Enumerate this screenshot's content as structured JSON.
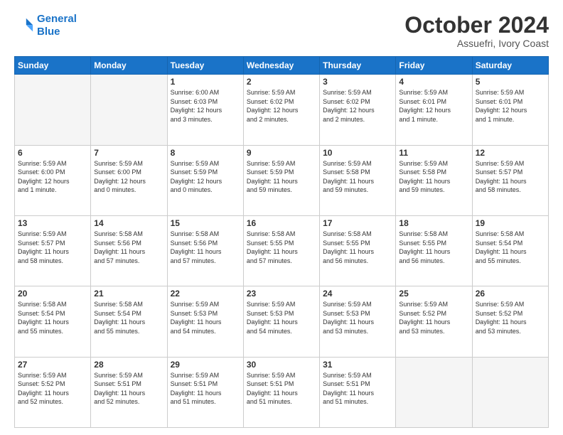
{
  "header": {
    "logo_line1": "General",
    "logo_line2": "Blue",
    "month": "October 2024",
    "location": "Assuefri, Ivory Coast"
  },
  "weekdays": [
    "Sunday",
    "Monday",
    "Tuesday",
    "Wednesday",
    "Thursday",
    "Friday",
    "Saturday"
  ],
  "weeks": [
    [
      {
        "day": "",
        "info": ""
      },
      {
        "day": "",
        "info": ""
      },
      {
        "day": "1",
        "info": "Sunrise: 6:00 AM\nSunset: 6:03 PM\nDaylight: 12 hours\nand 3 minutes."
      },
      {
        "day": "2",
        "info": "Sunrise: 5:59 AM\nSunset: 6:02 PM\nDaylight: 12 hours\nand 2 minutes."
      },
      {
        "day": "3",
        "info": "Sunrise: 5:59 AM\nSunset: 6:02 PM\nDaylight: 12 hours\nand 2 minutes."
      },
      {
        "day": "4",
        "info": "Sunrise: 5:59 AM\nSunset: 6:01 PM\nDaylight: 12 hours\nand 1 minute."
      },
      {
        "day": "5",
        "info": "Sunrise: 5:59 AM\nSunset: 6:01 PM\nDaylight: 12 hours\nand 1 minute."
      }
    ],
    [
      {
        "day": "6",
        "info": "Sunrise: 5:59 AM\nSunset: 6:00 PM\nDaylight: 12 hours\nand 1 minute."
      },
      {
        "day": "7",
        "info": "Sunrise: 5:59 AM\nSunset: 6:00 PM\nDaylight: 12 hours\nand 0 minutes."
      },
      {
        "day": "8",
        "info": "Sunrise: 5:59 AM\nSunset: 5:59 PM\nDaylight: 12 hours\nand 0 minutes."
      },
      {
        "day": "9",
        "info": "Sunrise: 5:59 AM\nSunset: 5:59 PM\nDaylight: 11 hours\nand 59 minutes."
      },
      {
        "day": "10",
        "info": "Sunrise: 5:59 AM\nSunset: 5:58 PM\nDaylight: 11 hours\nand 59 minutes."
      },
      {
        "day": "11",
        "info": "Sunrise: 5:59 AM\nSunset: 5:58 PM\nDaylight: 11 hours\nand 59 minutes."
      },
      {
        "day": "12",
        "info": "Sunrise: 5:59 AM\nSunset: 5:57 PM\nDaylight: 11 hours\nand 58 minutes."
      }
    ],
    [
      {
        "day": "13",
        "info": "Sunrise: 5:59 AM\nSunset: 5:57 PM\nDaylight: 11 hours\nand 58 minutes."
      },
      {
        "day": "14",
        "info": "Sunrise: 5:58 AM\nSunset: 5:56 PM\nDaylight: 11 hours\nand 57 minutes."
      },
      {
        "day": "15",
        "info": "Sunrise: 5:58 AM\nSunset: 5:56 PM\nDaylight: 11 hours\nand 57 minutes."
      },
      {
        "day": "16",
        "info": "Sunrise: 5:58 AM\nSunset: 5:55 PM\nDaylight: 11 hours\nand 57 minutes."
      },
      {
        "day": "17",
        "info": "Sunrise: 5:58 AM\nSunset: 5:55 PM\nDaylight: 11 hours\nand 56 minutes."
      },
      {
        "day": "18",
        "info": "Sunrise: 5:58 AM\nSunset: 5:55 PM\nDaylight: 11 hours\nand 56 minutes."
      },
      {
        "day": "19",
        "info": "Sunrise: 5:58 AM\nSunset: 5:54 PM\nDaylight: 11 hours\nand 55 minutes."
      }
    ],
    [
      {
        "day": "20",
        "info": "Sunrise: 5:58 AM\nSunset: 5:54 PM\nDaylight: 11 hours\nand 55 minutes."
      },
      {
        "day": "21",
        "info": "Sunrise: 5:58 AM\nSunset: 5:54 PM\nDaylight: 11 hours\nand 55 minutes."
      },
      {
        "day": "22",
        "info": "Sunrise: 5:59 AM\nSunset: 5:53 PM\nDaylight: 11 hours\nand 54 minutes."
      },
      {
        "day": "23",
        "info": "Sunrise: 5:59 AM\nSunset: 5:53 PM\nDaylight: 11 hours\nand 54 minutes."
      },
      {
        "day": "24",
        "info": "Sunrise: 5:59 AM\nSunset: 5:53 PM\nDaylight: 11 hours\nand 53 minutes."
      },
      {
        "day": "25",
        "info": "Sunrise: 5:59 AM\nSunset: 5:52 PM\nDaylight: 11 hours\nand 53 minutes."
      },
      {
        "day": "26",
        "info": "Sunrise: 5:59 AM\nSunset: 5:52 PM\nDaylight: 11 hours\nand 53 minutes."
      }
    ],
    [
      {
        "day": "27",
        "info": "Sunrise: 5:59 AM\nSunset: 5:52 PM\nDaylight: 11 hours\nand 52 minutes."
      },
      {
        "day": "28",
        "info": "Sunrise: 5:59 AM\nSunset: 5:51 PM\nDaylight: 11 hours\nand 52 minutes."
      },
      {
        "day": "29",
        "info": "Sunrise: 5:59 AM\nSunset: 5:51 PM\nDaylight: 11 hours\nand 51 minutes."
      },
      {
        "day": "30",
        "info": "Sunrise: 5:59 AM\nSunset: 5:51 PM\nDaylight: 11 hours\nand 51 minutes."
      },
      {
        "day": "31",
        "info": "Sunrise: 5:59 AM\nSunset: 5:51 PM\nDaylight: 11 hours\nand 51 minutes."
      },
      {
        "day": "",
        "info": ""
      },
      {
        "day": "",
        "info": ""
      }
    ]
  ]
}
